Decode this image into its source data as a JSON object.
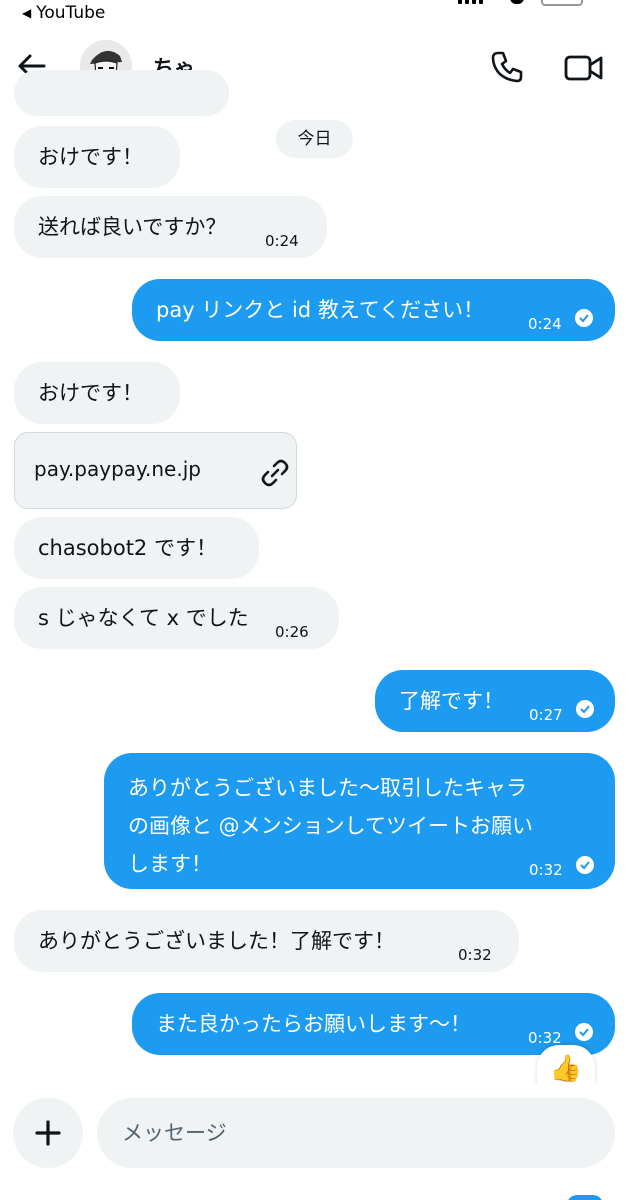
{
  "status_bar": {
    "back_app": "YouTube"
  },
  "header": {
    "name": "ちゃ"
  },
  "date_chip": "今日",
  "messages": {
    "m0": {
      "text": "おけです！"
    },
    "m1": {
      "text": "送れば良いですか？",
      "time": "0:24"
    },
    "m2": {
      "text": "pay リンクと id 教えてください！",
      "time": "0:24"
    },
    "m3": {
      "text": "おけです！"
    },
    "m4": {
      "url": "pay.paypay.ne.jp"
    },
    "m5": {
      "text": "chasobot2 です！"
    },
    "m6": {
      "text": "s じゃなくて x でした",
      "time": "0:26"
    },
    "m7": {
      "text": "了解です！",
      "time": "0:27"
    },
    "m8": {
      "line1": "ありがとうございました〜取引したキャラ",
      "line2": "の画像と @メンションしてツイートお願い",
      "line3": "します！",
      "time": "0:32"
    },
    "m9": {
      "text": "ありがとうございました！了解です！",
      "time": "0:32"
    },
    "m10": {
      "text": "また良かったらお願いします〜！",
      "time": "0:32",
      "reaction": "👍"
    }
  },
  "composer": {
    "placeholder": "メッセージ"
  },
  "colors": {
    "accent": "#1d9bf0",
    "received_bubble": "#eff3f4",
    "text": "#0f1419"
  },
  "icons": [
    "back-arrow-icon",
    "phone-icon",
    "video-icon",
    "link-icon",
    "check-icon",
    "plus-icon",
    "thumbs-up-icon"
  ]
}
